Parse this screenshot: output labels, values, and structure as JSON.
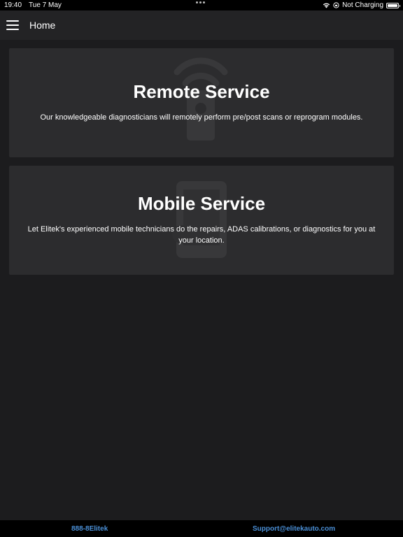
{
  "status_bar": {
    "time": "19:40",
    "date": "Tue 7 May",
    "charging": "Not Charging",
    "icons": [
      "wifi-icon",
      "orientation-lock-icon",
      "battery-icon"
    ]
  },
  "nav": {
    "title": "Home",
    "menu_icon": "hamburger-menu-icon"
  },
  "cards": [
    {
      "title": "Remote Service",
      "description": "Our knowledgeable diagnosticians will remotely perform pre/post scans or reprogram modules.",
      "icon": "remote-signal-icon"
    },
    {
      "title": "Mobile Service",
      "description": "Let Elitek's experienced mobile technicians do the repairs, ADAS calibrations, or diagnostics for you at your location.",
      "icon": "mobile-phone-icon"
    }
  ],
  "footer": {
    "phone": "888-8Elitek",
    "email": "Support@elitekauto.com"
  },
  "colors": {
    "background": "#1c1c1e",
    "card": "#2c2c2e",
    "link": "#4a8fd6"
  }
}
